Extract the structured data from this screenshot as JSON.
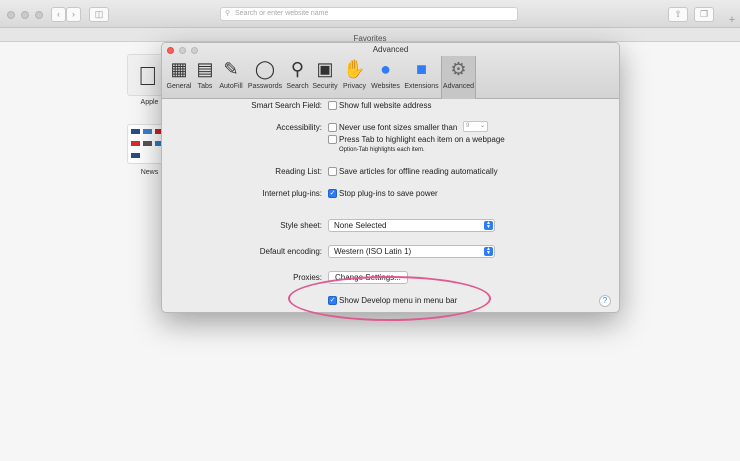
{
  "browser": {
    "address_placeholder": "Search or enter website name",
    "favorites_title": "Favorites",
    "favorites": [
      {
        "label": "Apple"
      },
      {
        "label": "News"
      }
    ]
  },
  "prefs": {
    "title": "Advanced",
    "tabs": [
      {
        "label": "General",
        "icon": "general-icon"
      },
      {
        "label": "Tabs",
        "icon": "tabs-icon"
      },
      {
        "label": "AutoFill",
        "icon": "autofill-icon"
      },
      {
        "label": "Passwords",
        "icon": "key-icon"
      },
      {
        "label": "Search",
        "icon": "search-icon"
      },
      {
        "label": "Security",
        "icon": "lock-icon"
      },
      {
        "label": "Privacy",
        "icon": "hand-icon"
      },
      {
        "label": "Websites",
        "icon": "globe-icon"
      },
      {
        "label": "Extensions",
        "icon": "extensions-icon"
      },
      {
        "label": "Advanced",
        "icon": "gear-icon"
      }
    ],
    "selected_tab": "Advanced",
    "smart_search": {
      "label": "Smart Search Field:",
      "show_full_address": {
        "label": "Show full website address",
        "checked": false
      }
    },
    "accessibility": {
      "label": "Accessibility:",
      "never_font_sizes": {
        "label": "Never use font sizes smaller than",
        "checked": false,
        "value": "9"
      },
      "press_tab": {
        "label": "Press Tab to highlight each item on a webpage",
        "checked": false
      },
      "hint": "Option-Tab highlights each item."
    },
    "reading_list": {
      "label": "Reading List:",
      "save_articles": {
        "label": "Save articles for offline reading automatically",
        "checked": false
      }
    },
    "plugins": {
      "label": "Internet plug-ins:",
      "stop_plugins": {
        "label": "Stop plug-ins to save power",
        "checked": true
      }
    },
    "style_sheet": {
      "label": "Style sheet:",
      "value": "None Selected"
    },
    "default_encoding": {
      "label": "Default encoding:",
      "value": "Western (ISO Latin 1)"
    },
    "proxies": {
      "label": "Proxies:",
      "button": "Change Settings..."
    },
    "develop_menu": {
      "label": "Show Develop menu in menu bar",
      "checked": true
    },
    "help": "?"
  },
  "colors": {
    "accent": "#2e7cf6",
    "highlight": "#e05a92"
  }
}
